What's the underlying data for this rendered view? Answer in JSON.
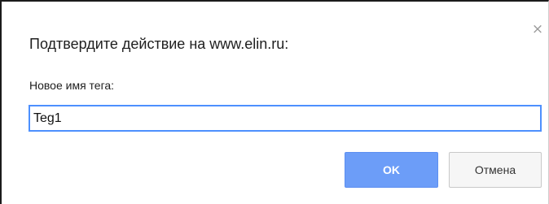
{
  "dialog": {
    "title": "Подтвердите действие на www.elin.ru:",
    "close_glyph": "×",
    "prompt_label": "Новое имя тега:",
    "input_value": "Teg1",
    "ok_label": "OK",
    "cancel_label": "Отмена"
  },
  "colors": {
    "ok_button": "#6c9df8",
    "input_focus_border": "#4d90fe",
    "cancel_button": "#f6f6f6"
  },
  "icons": {
    "close": "close-icon"
  }
}
